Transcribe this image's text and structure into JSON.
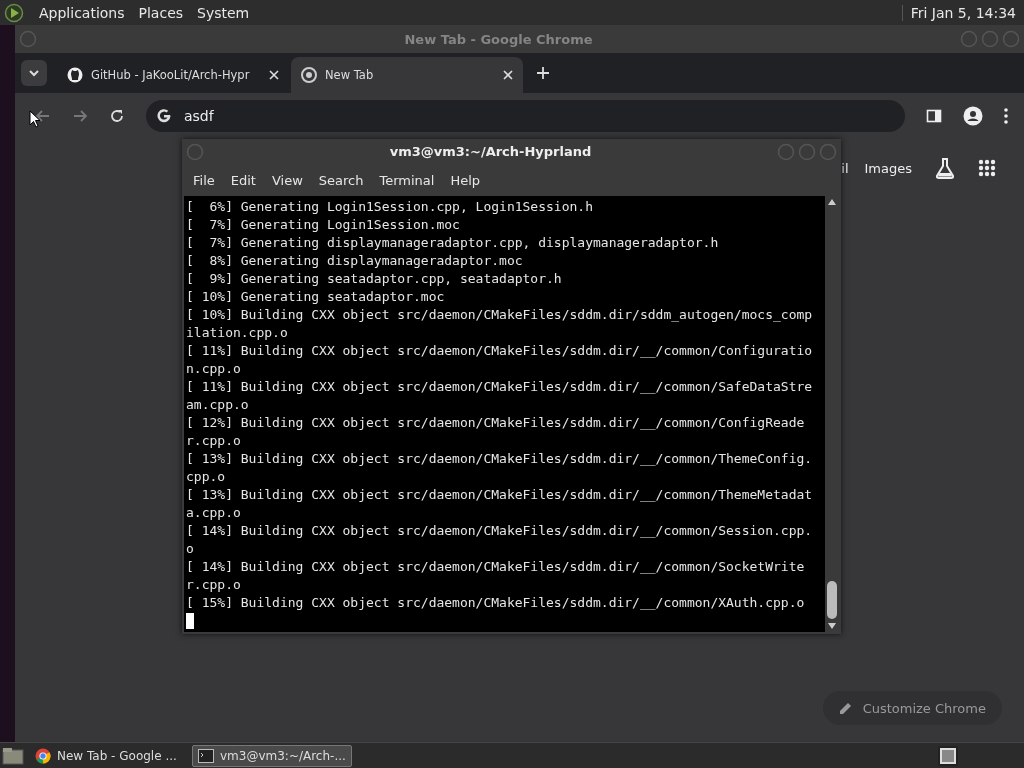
{
  "top_panel": {
    "menus": [
      "Applications",
      "Places",
      "System"
    ],
    "clock": "Fri Jan  5, 14:34"
  },
  "browser": {
    "title": "New Tab - Google Chrome",
    "tabs": [
      {
        "title": "GitHub - JaKooLit/Arch-Hypr",
        "selected": false
      },
      {
        "title": "New Tab",
        "selected": true
      }
    ],
    "address": {
      "value": "asdf"
    },
    "links": [
      {
        "kind": "partial",
        "label": "il"
      },
      {
        "kind": "text",
        "label": "Images"
      }
    ],
    "customize_button": "Customize Chrome"
  },
  "terminal": {
    "title": "vm3@vm3:~/Arch-Hyprland",
    "menu": [
      "File",
      "Edit",
      "View",
      "Search",
      "Terminal",
      "Help"
    ],
    "lines": [
      "[  6%] Generating Login1Session.cpp, Login1Session.h",
      "[  7%] Generating Login1Session.moc",
      "[  7%] Generating displaymanageradaptor.cpp, displaymanageradaptor.h",
      "[  8%] Generating displaymanageradaptor.moc",
      "[  9%] Generating seatadaptor.cpp, seatadaptor.h",
      "[ 10%] Generating seatadaptor.moc",
      "[ 10%] Building CXX object src/daemon/CMakeFiles/sddm.dir/sddm_autogen/mocs_compilation.cpp.o",
      "[ 11%] Building CXX object src/daemon/CMakeFiles/sddm.dir/__/common/Configuration.cpp.o",
      "[ 11%] Building CXX object src/daemon/CMakeFiles/sddm.dir/__/common/SafeDataStream.cpp.o",
      "[ 12%] Building CXX object src/daemon/CMakeFiles/sddm.dir/__/common/ConfigReader.cpp.o",
      "[ 13%] Building CXX object src/daemon/CMakeFiles/sddm.dir/__/common/ThemeConfig.cpp.o",
      "[ 13%] Building CXX object src/daemon/CMakeFiles/sddm.dir/__/common/ThemeMetadata.cpp.o",
      "[ 14%] Building CXX object src/daemon/CMakeFiles/sddm.dir/__/common/Session.cpp.o",
      "[ 14%] Building CXX object src/daemon/CMakeFiles/sddm.dir/__/common/SocketWriter.cpp.o",
      "[ 15%] Building CXX object src/daemon/CMakeFiles/sddm.dir/__/common/XAuth.cpp.o"
    ]
  },
  "taskbar": {
    "items": [
      {
        "kind": "browser",
        "label": "New Tab - Google ...",
        "selected": false
      },
      {
        "kind": "terminal",
        "label": "vm3@vm3:~/Arch-...",
        "selected": true
      }
    ]
  }
}
